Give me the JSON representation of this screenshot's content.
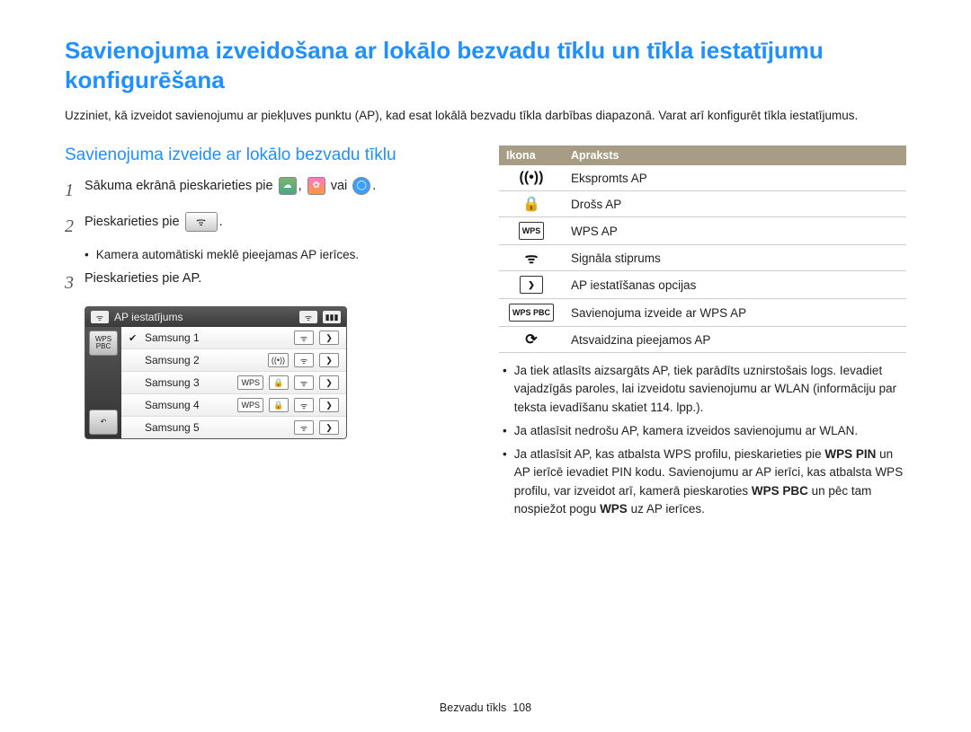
{
  "title": "Savienojuma izveidošana ar lokālo bezvadu tīklu un tīkla iestatījumu konfigurēšana",
  "intro": "Uzziniet, kā izveidot savienojumu ar piekļuves punktu (AP), kad esat lokālā bezvadu tīkla darbības diapazonā. Varat arī konfigurēt tīkla iestatījumus.",
  "subtitle": "Savienojuma izveide ar lokālo bezvadu tīklu",
  "steps": {
    "s1_pre": "Sākuma ekrānā pieskarieties pie ",
    "s1_mid": ", ",
    "s1_or": " vai ",
    "s1_end": ".",
    "s2_pre": "Pieskarieties pie ",
    "s2_end": ".",
    "s2_sub": "Kamera automātiski meklē pieejamas AP ierīces.",
    "s3": "Pieskarieties pie AP."
  },
  "ap_widget": {
    "title": "AP iestatījums",
    "side": {
      "wps": "WPS\nPBC",
      "back": "↶"
    },
    "items": [
      {
        "name": "Samsung 1",
        "checked": true,
        "badges": [
          "wifi",
          "next"
        ]
      },
      {
        "name": "Samsung 2",
        "checked": false,
        "badges": [
          "antenna",
          "wifi",
          "next"
        ]
      },
      {
        "name": "Samsung 3",
        "checked": false,
        "badges": [
          "WPS",
          "lock",
          "wifi",
          "next"
        ]
      },
      {
        "name": "Samsung 4",
        "checked": false,
        "badges": [
          "WPS",
          "lock",
          "wifi",
          "next"
        ]
      },
      {
        "name": "Samsung 5",
        "checked": false,
        "badges": [
          "wifi",
          "next"
        ]
      }
    ]
  },
  "table": {
    "head": {
      "icon": "Ikona",
      "desc": "Apraksts"
    },
    "rows": [
      {
        "iconText": "((•))",
        "iconClass": "noborder",
        "desc": "Ekspromts AP"
      },
      {
        "iconText": "🔒",
        "iconClass": "noborder",
        "desc": "Drošs AP"
      },
      {
        "iconText": "WPS",
        "iconClass": "",
        "desc": "WPS AP"
      },
      {
        "iconText": "ᯤ",
        "iconClass": "noborder",
        "desc": "Signāla stiprums"
      },
      {
        "iconText": "❯",
        "iconClass": "",
        "desc": "AP iestatīšanas opcijas"
      },
      {
        "iconText": "WPS PBC",
        "iconClass": "",
        "desc": "Savienojuma izveide ar WPS AP"
      },
      {
        "iconText": "⟳",
        "iconClass": "noborder",
        "desc": "Atsvaidzina pieejamos AP"
      }
    ]
  },
  "notes": {
    "n1": "Ja tiek atlasīts aizsargāts AP, tiek parādīts uznirstošais logs. Ievadiet vajadzīgās paroles, lai izveidotu savienojumu ar WLAN (informāciju par teksta ievadīšanu skatiet 114. lpp.).",
    "n2": "Ja atlasīsit nedrošu AP, kamera izveidos savienojumu ar WLAN.",
    "n3_a": "Ja atlasīsit AP, kas atbalsta WPS profilu, pieskarieties pie ",
    "n3_b": "WPS PIN",
    "n3_c": " un AP ierīcē ievadiet PIN kodu. Savienojumu ar AP ierīci, kas atbalsta WPS profilu, var izveidot arī, kamerā pieskaroties ",
    "n3_d": "WPS PBC",
    "n3_e": " un pēc tam nospiežot pogu ",
    "n3_f": "WPS",
    "n3_g": " uz AP ierīces."
  },
  "footer": {
    "label": "Bezvadu tīkls",
    "page": "108"
  }
}
